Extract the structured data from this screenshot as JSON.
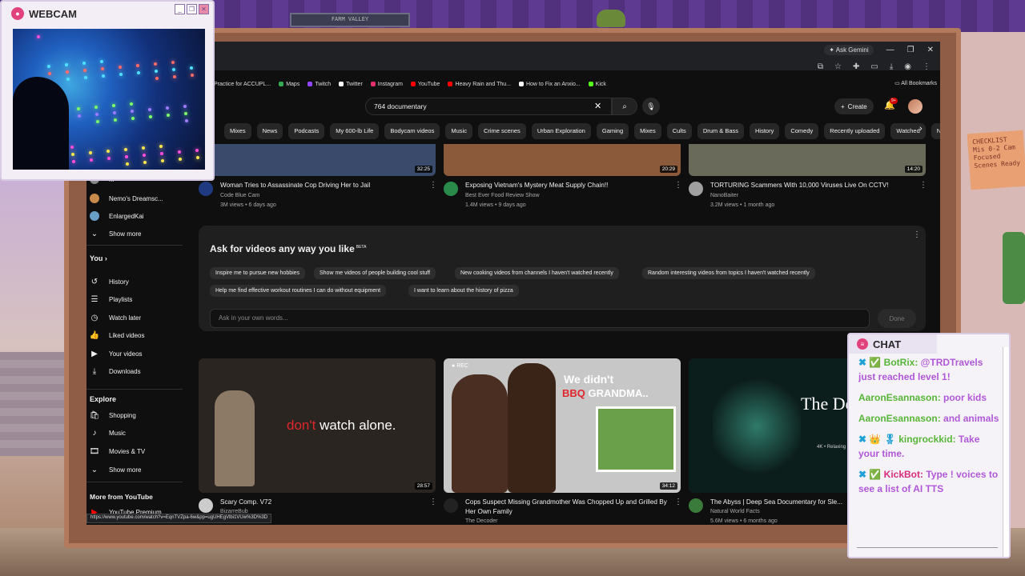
{
  "overlay": {
    "webcam_title": "WEBCAM",
    "chat_title": "CHAT",
    "chat_messages": [
      {
        "prefix": "✖ ✅ ",
        "user": "BotRix:",
        "text": " @TRDTravels just reached level 1!"
      },
      {
        "prefix": "",
        "user": "AaronEsannason:",
        "text": " poor kids"
      },
      {
        "prefix": "",
        "user": "AaronEsannason:",
        "text": " and animals"
      },
      {
        "prefix": "✖ 👑 🎖 ",
        "user": "kingrockkid:",
        "text": " Take your time."
      },
      {
        "prefix": "✖ ✅ ",
        "user": "KickBot:",
        "text": " Type ! voices to see a list of AI TTS"
      }
    ],
    "sticky_note": "CHECKLIST Mis 0-2 Cam Focused Scenes Ready",
    "sign_text": "FARM VALLEY"
  },
  "browser": {
    "gemini_label": "Ask Gemini",
    "all_bookmarks": "All Bookmarks",
    "bookmarks": [
      {
        "label": "Practice for ACCUPL...",
        "color": "#4285f4"
      },
      {
        "label": "Maps",
        "color": "#34a853"
      },
      {
        "label": "Twitch",
        "color": "#9146ff"
      },
      {
        "label": "Twitter",
        "color": "#ffffff"
      },
      {
        "label": "Instagram",
        "color": "#e1306c"
      },
      {
        "label": "YouTube",
        "color": "#ff0000"
      },
      {
        "label": "Heavy Rain and Thu...",
        "color": "#ff0000"
      },
      {
        "label": "How to Fix an Anxio...",
        "color": "#ffffff"
      },
      {
        "label": "Kick",
        "color": "#53fc18"
      }
    ],
    "status_url": "https://www.youtube.com/watch?v=EqnTVZpa-6w&pp=ugUHEgVlbi1VUw%3D%3D"
  },
  "youtube": {
    "search_value": "764 documentary",
    "create_label": "Create",
    "notif_count": "9+",
    "chips": [
      "Mixes",
      "News",
      "Podcasts",
      "My 600-lb Life",
      "Bodycam videos",
      "Music",
      "Crime scenes",
      "Urban Exploration",
      "Gaming",
      "Mixes",
      "Cults",
      "Drum & Bass",
      "History",
      "Comedy",
      "Recently uploaded",
      "Watched",
      "N"
    ],
    "sidebar": {
      "subs": [
        {
          "label": "...",
          "color": "#888"
        },
        {
          "label": "Nemo's Dreamsc...",
          "color": "#c98a4b"
        },
        {
          "label": "EnlargedKai",
          "color": "#6aa0c8"
        }
      ],
      "show_more": "Show more",
      "you_heading": "You",
      "you_items": [
        {
          "icon": "history-icon",
          "glyph": "↺",
          "label": "History"
        },
        {
          "icon": "playlists-icon",
          "glyph": "☰",
          "label": "Playlists"
        },
        {
          "icon": "watch-later-icon",
          "glyph": "◷",
          "label": "Watch later"
        },
        {
          "icon": "liked-videos-icon",
          "glyph": "👍",
          "label": "Liked videos"
        },
        {
          "icon": "your-videos-icon",
          "glyph": "▶",
          "label": "Your videos"
        },
        {
          "icon": "downloads-icon",
          "glyph": "⤓",
          "label": "Downloads"
        }
      ],
      "explore_heading": "Explore",
      "explore_items": [
        {
          "icon": "shopping-icon",
          "glyph": "🛍",
          "label": "Shopping"
        },
        {
          "icon": "music-icon",
          "glyph": "♪",
          "label": "Music"
        },
        {
          "icon": "movies-tv-icon",
          "glyph": "🎞",
          "label": "Movies & TV"
        }
      ],
      "more_heading": "More from YouTube",
      "premium_label": "YouTube Premium"
    },
    "row1": [
      {
        "title": "Woman Tries to Assassinate Cop Driving Her to Jail",
        "channel": "Code Blue Cam",
        "meta": "3M views • 6 days ago",
        "duration": "32:25",
        "thumb": "#3a4a6a",
        "avatar": "#1f3a80"
      },
      {
        "title": "Exposing Vietnam's Mystery Meat Supply Chain!!",
        "channel": "Best Ever Food Review Show",
        "meta": "1.4M views • 9 days ago",
        "duration": "20:29",
        "thumb": "#8a5a3a",
        "avatar": "#2a8a4a"
      },
      {
        "title": "TORTURING Scammers With 10,000 Viruses Live On CCTV!",
        "channel": "NanoBaiter",
        "meta": "3.2M views • 1 month ago",
        "duration": "14:20",
        "thumb": "#6a6a5a",
        "avatar": "#a0a0a0"
      }
    ],
    "ask": {
      "title": "Ask for videos any way you like",
      "beta": "BETA",
      "suggestions": [
        "Inspire me to pursue new hobbies",
        "Show me videos of people building cool stuff",
        "New cooking videos from channels I haven't watched recently",
        "Random interesting videos from topics I haven't watched recently",
        "Help me find effective workout routines I can do without equipment",
        "I want to learn about the history of pizza"
      ],
      "placeholder": "Ask in your own words...",
      "done_label": "Done"
    },
    "row2": [
      {
        "title": "Scary Comp. V72",
        "channel": "BizarreBub",
        "meta": "",
        "duration": "28:57",
        "overlay_red": "don't",
        "overlay_white": " watch alone."
      },
      {
        "title": "Cops Suspect Missing Grandmother Was Chopped Up and Grilled By Her Own Family",
        "channel": "The Decoder",
        "meta": "",
        "duration": "34:12",
        "rec": "REC",
        "overlay_white": "We didn't",
        "overlay_red": "BBQ",
        "overlay_white2": " GRANDMA.."
      },
      {
        "title": "The Abyss | Deep Sea Documentary for Sle...",
        "channel": "Natural World Facts",
        "meta": "5.6M views • 6 months ago",
        "duration": "",
        "overlay_white": "The Deep SE",
        "overlay_sub": "4K • Relaxing"
      }
    ]
  }
}
